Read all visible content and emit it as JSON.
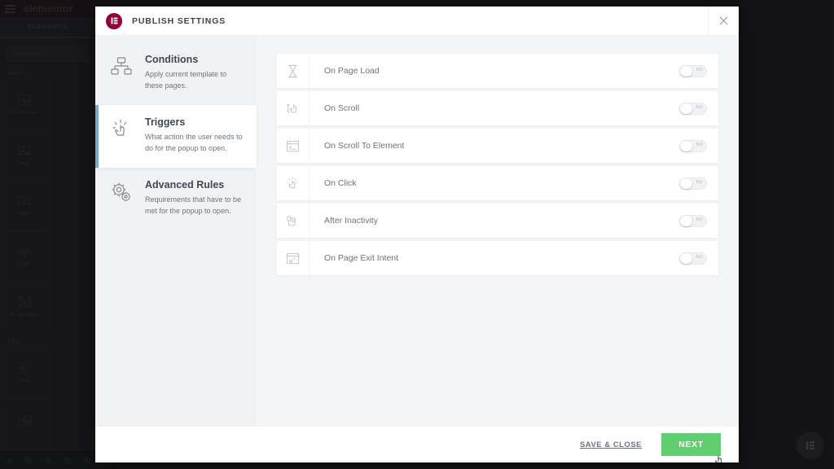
{
  "background_editor": {
    "logo_text": "elementor",
    "hamburger_icon": "hamburger-icon",
    "tab_label": "ELEMENTS",
    "search_placeholder": "Search Widget...",
    "group_basic_label": "BASIC",
    "group_pro_label": "PRO",
    "widgets_basic": [
      {
        "label": "Inner Section",
        "icon": "inner-section-icon"
      },
      {
        "label": "Image",
        "icon": "image-icon"
      },
      {
        "label": "Video",
        "icon": "video-icon"
      },
      {
        "label": "Divider",
        "icon": "divider-icon"
      },
      {
        "label": "Google Maps",
        "icon": "google-maps-icon"
      }
    ],
    "widgets_pro": [
      {
        "label": "Posts",
        "icon": "posts-icon"
      },
      {
        "label": "",
        "icon": "portfolio-icon"
      }
    ],
    "fab_icon": "elementor-logo-icon"
  },
  "modal": {
    "brand_icon": "elementor-logo-icon",
    "title": "PUBLISH SETTINGS",
    "close_icon": "close-icon",
    "nav": [
      {
        "id": "conditions",
        "title": "Conditions",
        "desc": "Apply current template to these pages.",
        "icon": "sitemap-icon",
        "active": false
      },
      {
        "id": "triggers",
        "title": "Triggers",
        "desc": "What action the user needs to do for the popup to open.",
        "icon": "click-hand-icon",
        "active": true
      },
      {
        "id": "advanced-rules",
        "title": "Advanced Rules",
        "desc": "Requirements that have to be met for the popup to open.",
        "icon": "gears-icon",
        "active": false
      }
    ],
    "triggers": [
      {
        "label": "On Page Load",
        "icon": "hourglass-icon",
        "toggle_value": "NO",
        "enabled": false
      },
      {
        "label": "On Scroll",
        "icon": "scroll-hand-icon",
        "toggle_value": "NO",
        "enabled": false
      },
      {
        "label": "On Scroll To Element",
        "icon": "browser-code-icon",
        "toggle_value": "NO",
        "enabled": false
      },
      {
        "label": "On Click",
        "icon": "click-hand-icon",
        "toggle_value": "NO",
        "enabled": false
      },
      {
        "label": "After Inactivity",
        "icon": "inactivity-hand-icon",
        "toggle_value": "NO",
        "enabled": false
      },
      {
        "label": "On Page Exit Intent",
        "icon": "exit-intent-icon",
        "toggle_value": "NO",
        "enabled": false
      }
    ],
    "footer": {
      "save_close_label": "SAVE & CLOSE",
      "next_label": "NEXT",
      "next_color": "#61ce70"
    }
  },
  "colors": {
    "brand": "#92003b",
    "accent_active": "#79a9c7",
    "next_green": "#61ce70",
    "nav_bg": "#f1f2f3",
    "main_bg": "#f4f5f6"
  }
}
